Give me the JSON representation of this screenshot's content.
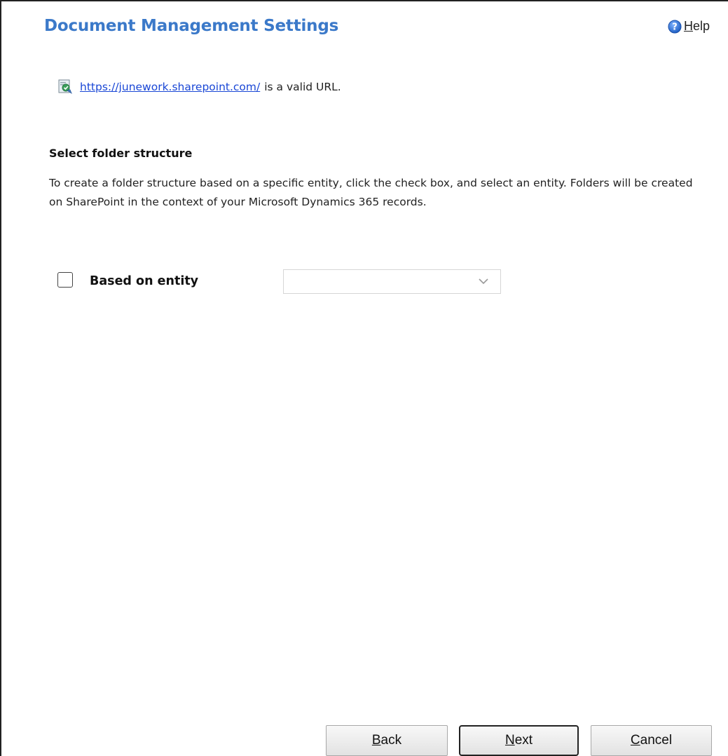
{
  "dialog": {
    "title": "Document Management Settings"
  },
  "help": {
    "accel": "H",
    "rest": "elp"
  },
  "validation": {
    "url": "https://junework.sharepoint.com/",
    "suffix": "is a valid URL."
  },
  "folder_section": {
    "title": "Select folder structure",
    "description": "To create a folder structure based on a specific entity, click the check box, and select an entity. Folders will be created on SharePoint in the context of your Microsoft Dynamics 365 records.",
    "checkbox_label": "Based on entity",
    "checkbox_checked": false,
    "entity_select_value": ""
  },
  "buttons": {
    "back": {
      "accel": "B",
      "rest": "ack"
    },
    "next": {
      "accel": "N",
      "rest": "ext"
    },
    "cancel": {
      "accel": "C",
      "rest": "ancel"
    }
  },
  "colors": {
    "title": "#3b79c9",
    "link": "#1a47d6",
    "help_icon": "#2b6fd6"
  },
  "icons": {
    "help": "help-circle-icon",
    "url_status": "sharepoint-valid-icon",
    "select": "chevron-down-icon"
  }
}
